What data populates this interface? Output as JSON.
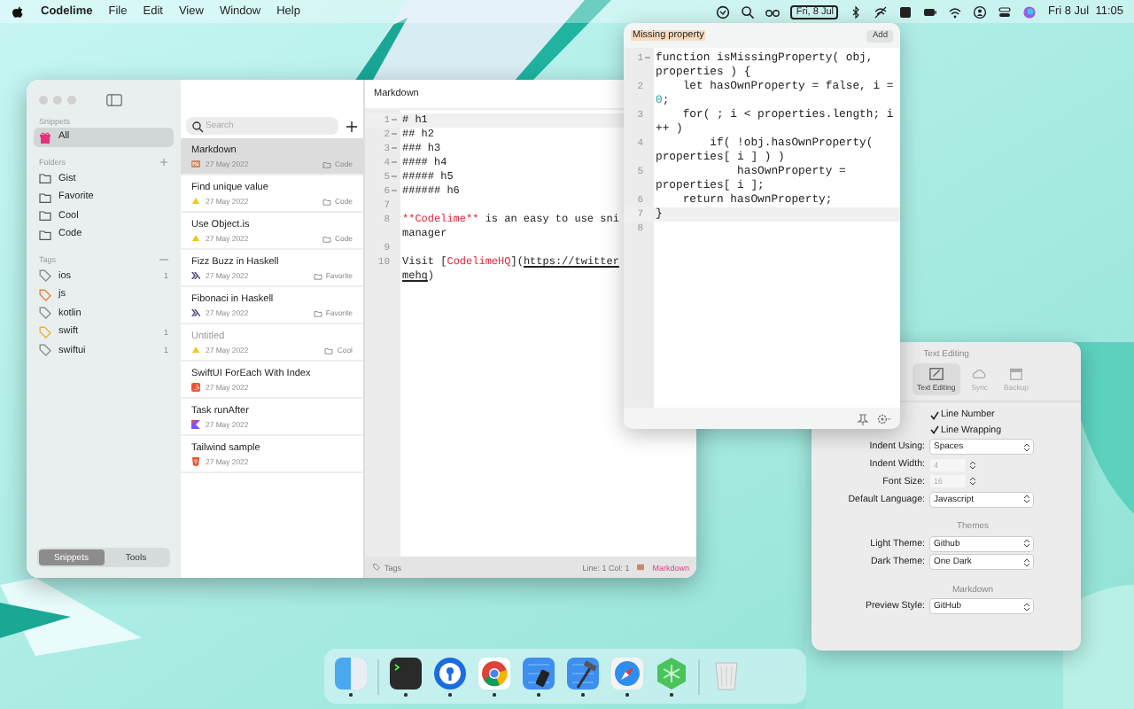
{
  "menu_bar": {
    "app_name": "Codelime",
    "menus": [
      "File",
      "Edit",
      "View",
      "Window",
      "Help"
    ],
    "date_badge": "Fri, 8 Jul",
    "clock": "Fri 8 Jul  11:05"
  },
  "sidebar": {
    "snippets_heading": "Snippets",
    "all_item": {
      "label": "All",
      "selected": true
    },
    "folders_heading": "Folders",
    "folders": [
      {
        "label": "Gist",
        "selected": false
      },
      {
        "label": "Favorite",
        "selected": false
      },
      {
        "label": "Cool",
        "selected": false
      },
      {
        "label": "Code",
        "selected": false
      }
    ],
    "tags_heading": "Tags",
    "tags": [
      {
        "label": "ios",
        "color": "#8e8e93",
        "count": "1"
      },
      {
        "label": "js",
        "color": "#e8833a"
      },
      {
        "label": "kotlin",
        "color": "#8e8e93"
      },
      {
        "label": "swift",
        "color": "#e8b23a",
        "count": "1"
      },
      {
        "label": "swiftui",
        "color": "#8e8e93",
        "count": "1"
      }
    ],
    "bottom_tabs": [
      {
        "label": "Snippets",
        "selected": true
      },
      {
        "label": "Tools",
        "selected": false
      }
    ]
  },
  "snippet_list": {
    "search": {
      "placeholder": "Search"
    },
    "items": [
      {
        "title": "Markdown",
        "kind": "markdown",
        "date": "27 May 2022",
        "folder": "Code",
        "selected": true,
        "dimmed": false
      },
      {
        "title": "Find unique value",
        "kind": "js",
        "date": "27 May 2022",
        "folder": "Code",
        "selected": false,
        "dimmed": false
      },
      {
        "title": "Use Object.is",
        "kind": "js",
        "date": "27 May 2022",
        "folder": "Code",
        "selected": false,
        "dimmed": false
      },
      {
        "title": "Fizz Buzz in Haskell",
        "kind": "haskell",
        "date": "27 May 2022",
        "folder": "Favorite",
        "selected": false,
        "dimmed": false
      },
      {
        "title": "Fibonaci in Haskell",
        "kind": "haskell",
        "date": "27 May 2022",
        "folder": "Favorite",
        "selected": false,
        "dimmed": false
      },
      {
        "title": "Untitled",
        "kind": "js",
        "date": "27 May 2022",
        "folder": "Cool",
        "selected": false,
        "dimmed": true
      },
      {
        "title": "SwiftUI ForEach With Index",
        "kind": "swift",
        "date": "27 May 2022",
        "selected": false,
        "dimmed": false
      },
      {
        "title": "Task runAfter",
        "kind": "kotlin",
        "date": "27 May 2022",
        "selected": false,
        "dimmed": false
      },
      {
        "title": "Tailwind sample",
        "kind": "html",
        "date": "27 May 2022",
        "selected": false,
        "dimmed": false
      }
    ]
  },
  "editor": {
    "title": "Markdown",
    "lines": [
      {
        "number": "1",
        "active": true,
        "fold": true,
        "rows": [
          {
            "segments": [
              {
                "text": "# h1",
                "kind": "text"
              }
            ]
          }
        ]
      },
      {
        "number": "2",
        "active": false,
        "fold": true,
        "rows": [
          {
            "segments": [
              {
                "text": "## h2",
                "kind": "text"
              }
            ]
          }
        ]
      },
      {
        "number": "3",
        "active": false,
        "fold": true,
        "rows": [
          {
            "segments": [
              {
                "text": "### h3",
                "kind": "text"
              }
            ]
          }
        ]
      },
      {
        "number": "4",
        "active": false,
        "fold": true,
        "rows": [
          {
            "segments": [
              {
                "text": "#### h4",
                "kind": "text"
              }
            ]
          }
        ]
      },
      {
        "number": "5",
        "active": false,
        "fold": true,
        "rows": [
          {
            "segments": [
              {
                "text": "##### h5",
                "kind": "text"
              }
            ]
          }
        ]
      },
      {
        "number": "6",
        "active": false,
        "fold": true,
        "rows": [
          {
            "segments": [
              {
                "text": "###### h6",
                "kind": "text"
              }
            ]
          }
        ]
      },
      {
        "number": "7",
        "active": false,
        "fold": false
      },
      {
        "number": "8",
        "active": false,
        "fold": false,
        "rows": [
          {
            "segments": [
              {
                "text": "**Codelime**",
                "kind": "emphasis"
              },
              {
                "text": " is an easy to use sni",
                "kind": "text"
              }
            ]
          },
          {
            "segments": [
              {
                "text": "manager",
                "kind": "text"
              }
            ]
          }
        ]
      },
      {
        "number": "9",
        "active": false,
        "fold": false
      },
      {
        "number": "10",
        "active": false,
        "fold": false,
        "rows": [
          {
            "segments": [
              {
                "text": "Visit [",
                "kind": "text"
              },
              {
                "text": "CodelimeHQ",
                "kind": "emphasis"
              },
              {
                "text": "](",
                "kind": "text"
              },
              {
                "text": "https://twitter",
                "kind": "url"
              }
            ]
          },
          {
            "segments": [
              {
                "text": "mehq",
                "kind": "url"
              },
              {
                "text": ")",
                "kind": "text"
              }
            ]
          }
        ]
      }
    ],
    "status": {
      "tags_label": "Tags",
      "position": "Line: 1 Col: 1",
      "mode": "Markdown"
    }
  },
  "popup": {
    "title": "Missing property",
    "add_button": "Add",
    "lines": [
      {
        "number": "1",
        "active": false,
        "fold": true,
        "rows": [
          {
            "segments": [
              {
                "text": "function isMissingProperty( obj,",
                "kind": "text"
              }
            ]
          },
          {
            "segments": [
              {
                "text": "properties ) {",
                "kind": "text"
              }
            ]
          }
        ]
      },
      {
        "number": "2",
        "active": false,
        "fold": false,
        "rows": [
          {
            "segments": [
              {
                "text": "    let hasOwnProperty = false, i =",
                "kind": "text"
              }
            ]
          },
          {
            "segments": [
              {
                "text": "0",
                "kind": "number"
              },
              {
                "text": ";",
                "kind": "text"
              }
            ]
          }
        ]
      },
      {
        "number": "3",
        "active": false,
        "fold": false,
        "rows": [
          {
            "segments": [
              {
                "text": "    for( ; i < properties.length; i",
                "kind": "text"
              }
            ]
          },
          {
            "segments": [
              {
                "text": "++ )",
                "kind": "text"
              }
            ]
          }
        ]
      },
      {
        "number": "4",
        "active": false,
        "fold": false,
        "rows": [
          {
            "segments": [
              {
                "text": "        if( !obj.hasOwnProperty(",
                "kind": "text"
              }
            ]
          },
          {
            "segments": [
              {
                "text": "properties[ i ] ) )",
                "kind": "text"
              }
            ]
          }
        ]
      },
      {
        "number": "5",
        "active": false,
        "fold": false,
        "rows": [
          {
            "segments": [
              {
                "text": "            hasOwnProperty =",
                "kind": "text"
              }
            ]
          },
          {
            "segments": [
              {
                "text": "properties[ i ];",
                "kind": "text"
              }
            ]
          }
        ]
      },
      {
        "number": "6",
        "active": false,
        "fold": false,
        "rows": [
          {
            "segments": [
              {
                "text": "    return hasOwnProperty;",
                "kind": "text"
              }
            ]
          }
        ]
      },
      {
        "number": "7",
        "active": true,
        "fold": false,
        "rows": [
          {
            "segments": [
              {
                "text": "}",
                "kind": "text"
              }
            ]
          }
        ]
      },
      {
        "number": "8",
        "active": false,
        "fold": false
      }
    ]
  },
  "settings": {
    "title": "Text Editing",
    "tabs": [
      {
        "label": "Text Editing",
        "kind": "editing",
        "selected": true
      },
      {
        "label": "Sync",
        "kind": "sync",
        "selected": false
      },
      {
        "label": "Backup",
        "kind": "backup",
        "selected": false
      }
    ],
    "rows": [
      {
        "kind": "checkbox",
        "label": "Line Number",
        "checked": true
      },
      {
        "kind": "checkbox",
        "label": "Line Wrapping",
        "checked": true
      },
      {
        "kind": "popup",
        "label": "Indent Using:",
        "value": "Spaces"
      },
      {
        "kind": "stepper",
        "label": "Indent Width:",
        "value": "4"
      },
      {
        "kind": "stepper",
        "label": "Font Size:",
        "value": "16"
      },
      {
        "kind": "popup",
        "label": "Default Language:",
        "value": "Javascript"
      },
      {
        "kind": "heading",
        "label": "Themes"
      },
      {
        "kind": "popup",
        "label": "Light Theme:",
        "value": "Github"
      },
      {
        "kind": "popup",
        "label": "Dark Theme:",
        "value": "One Dark"
      },
      {
        "kind": "heading",
        "label": "Markdown"
      },
      {
        "kind": "popup",
        "label": "Preview Style:",
        "value": "GitHub"
      }
    ]
  },
  "dock": {
    "items": [
      {
        "kind": "files",
        "running": true
      },
      {
        "kind": "terminal",
        "running": true
      },
      {
        "kind": "keyhole",
        "running": true
      },
      {
        "kind": "browser",
        "running": true
      },
      {
        "kind": "blueprint",
        "running": true
      },
      {
        "kind": "blueprint-hammer",
        "running": true
      },
      {
        "kind": "compass",
        "running": true
      },
      {
        "kind": "hexagon",
        "running": true
      },
      {
        "kind": "trash",
        "running": false
      }
    ]
  }
}
